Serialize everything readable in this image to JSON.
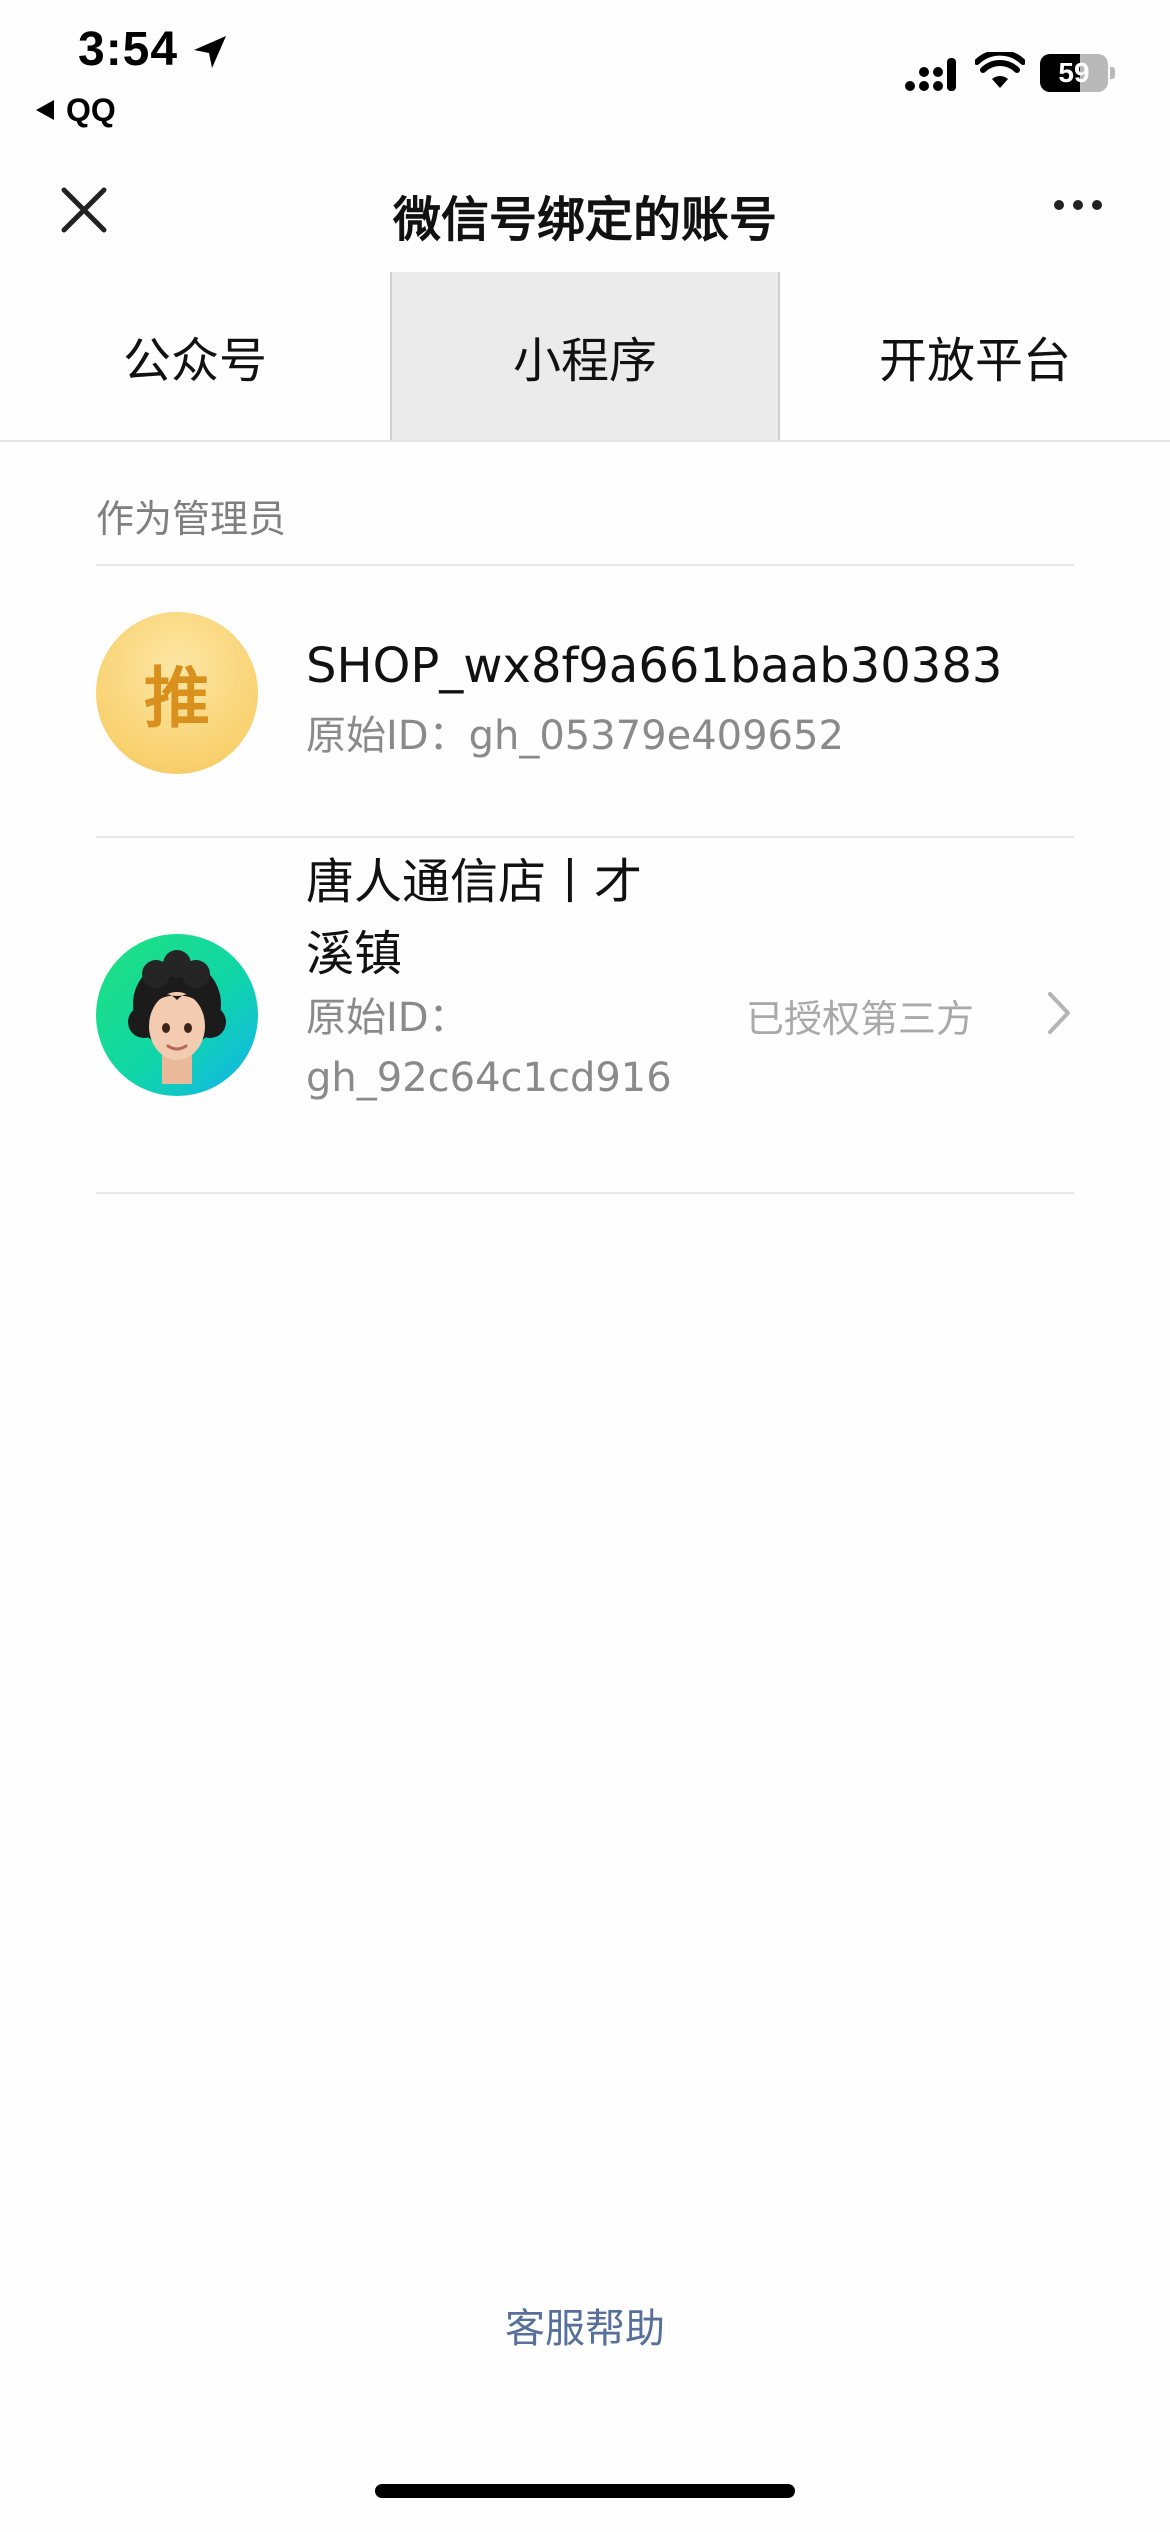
{
  "status_bar": {
    "time": "3:54",
    "back_app": "QQ",
    "battery_percent": "59",
    "battery_level": 0.59,
    "icons": [
      "location-arrow-icon",
      "cellular-signal-icon",
      "wifi-icon",
      "battery-icon"
    ]
  },
  "nav": {
    "title": "微信号绑定的账号",
    "close_icon": "close-icon",
    "more_icon": "more-dots-icon"
  },
  "tabs": [
    {
      "label": "公众号",
      "active": false
    },
    {
      "label": "小程序",
      "active": true
    },
    {
      "label": "开放平台",
      "active": false
    }
  ],
  "section": {
    "header": "作为管理员"
  },
  "accounts": [
    {
      "avatar_text": "推",
      "name": "SHOP_wx8f9a661baab30383",
      "id_label": "原始ID：",
      "id_value": "gh_05379e409652"
    },
    {
      "name_line1": "唐人通信店丨才",
      "name_line2": "溪镇",
      "id_label": "原始ID：",
      "id_value": "gh_92c64c1cd916",
      "status": "已授权第三方"
    }
  ],
  "footer": {
    "help_link": "客服帮助"
  },
  "colors": {
    "link": "#56709b",
    "secondary_text": "#8a8a8a",
    "active_tab_bg": "#ebebeb"
  }
}
